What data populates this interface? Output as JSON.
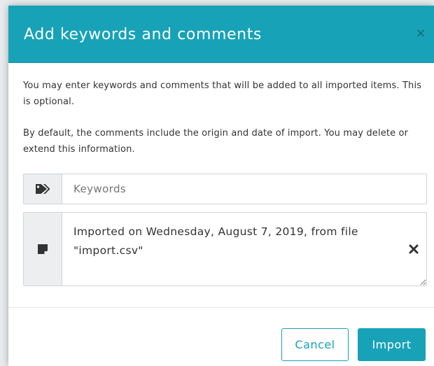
{
  "dialog": {
    "title": "Add keywords and comments",
    "close_symbol": "×",
    "paragraphs": [
      "You may enter keywords and comments that will be added to all imported items. This is optional.",
      "By default, the comments include the origin and date of import. You may delete or extend this information."
    ],
    "keywords": {
      "icon": "tags-icon",
      "placeholder": "Keywords",
      "value": ""
    },
    "comments": {
      "icon": "sticky-note-icon",
      "value": "Imported on Wednesday, August 7, 2019, from file \"import.csv\"",
      "clear_icon": "times-icon"
    },
    "buttons": {
      "cancel": "Cancel",
      "import": "Import"
    }
  },
  "colors": {
    "accent": "#17a2b8",
    "addon_bg": "#eceeef",
    "text": "#333333"
  }
}
